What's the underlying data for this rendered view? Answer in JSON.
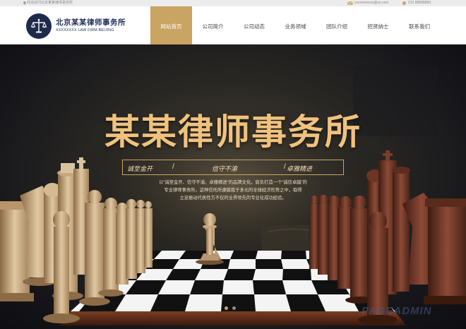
{
  "topbar": {
    "welcome": "欢迎访问北京某某律师事务所",
    "email": "xxxxxxxxxxx@xx.com",
    "phone": "010 88888888"
  },
  "header": {
    "logo_title": "北京某某律师事务所",
    "logo_subtitle": "XXXXXXXX LAW FIRM.BEIJING"
  },
  "nav": {
    "items": [
      {
        "label": "网站首页",
        "active": true
      },
      {
        "label": "公司简介",
        "active": false
      },
      {
        "label": "公司动态",
        "active": false
      },
      {
        "label": "业务领域",
        "active": false
      },
      {
        "label": "团队介绍",
        "active": false
      },
      {
        "label": "招贤纳士",
        "active": false
      },
      {
        "label": "联系我们",
        "active": false
      }
    ]
  },
  "banner": {
    "headline": "某某律师事务所",
    "slogans": [
      "诚至金开",
      "信守不渝",
      "卓雅精进"
    ],
    "description": [
      "以“诚至金开、信守不渝、卓雅精进”的品牌文化，肩负打造一个“诚信卓越”的",
      "专业律师事务所，这种信托所遵循我于多元的全球经济形势之中，取得",
      "立足振动代表性方不仅的业界领先的专业化成功经验。"
    ],
    "slides": 2,
    "active_slide": 1
  },
  "watermark": "PAGEADMIN",
  "colors": {
    "accent": "#c9a462",
    "navy": "#22305a",
    "headline": "#f0c27e"
  }
}
